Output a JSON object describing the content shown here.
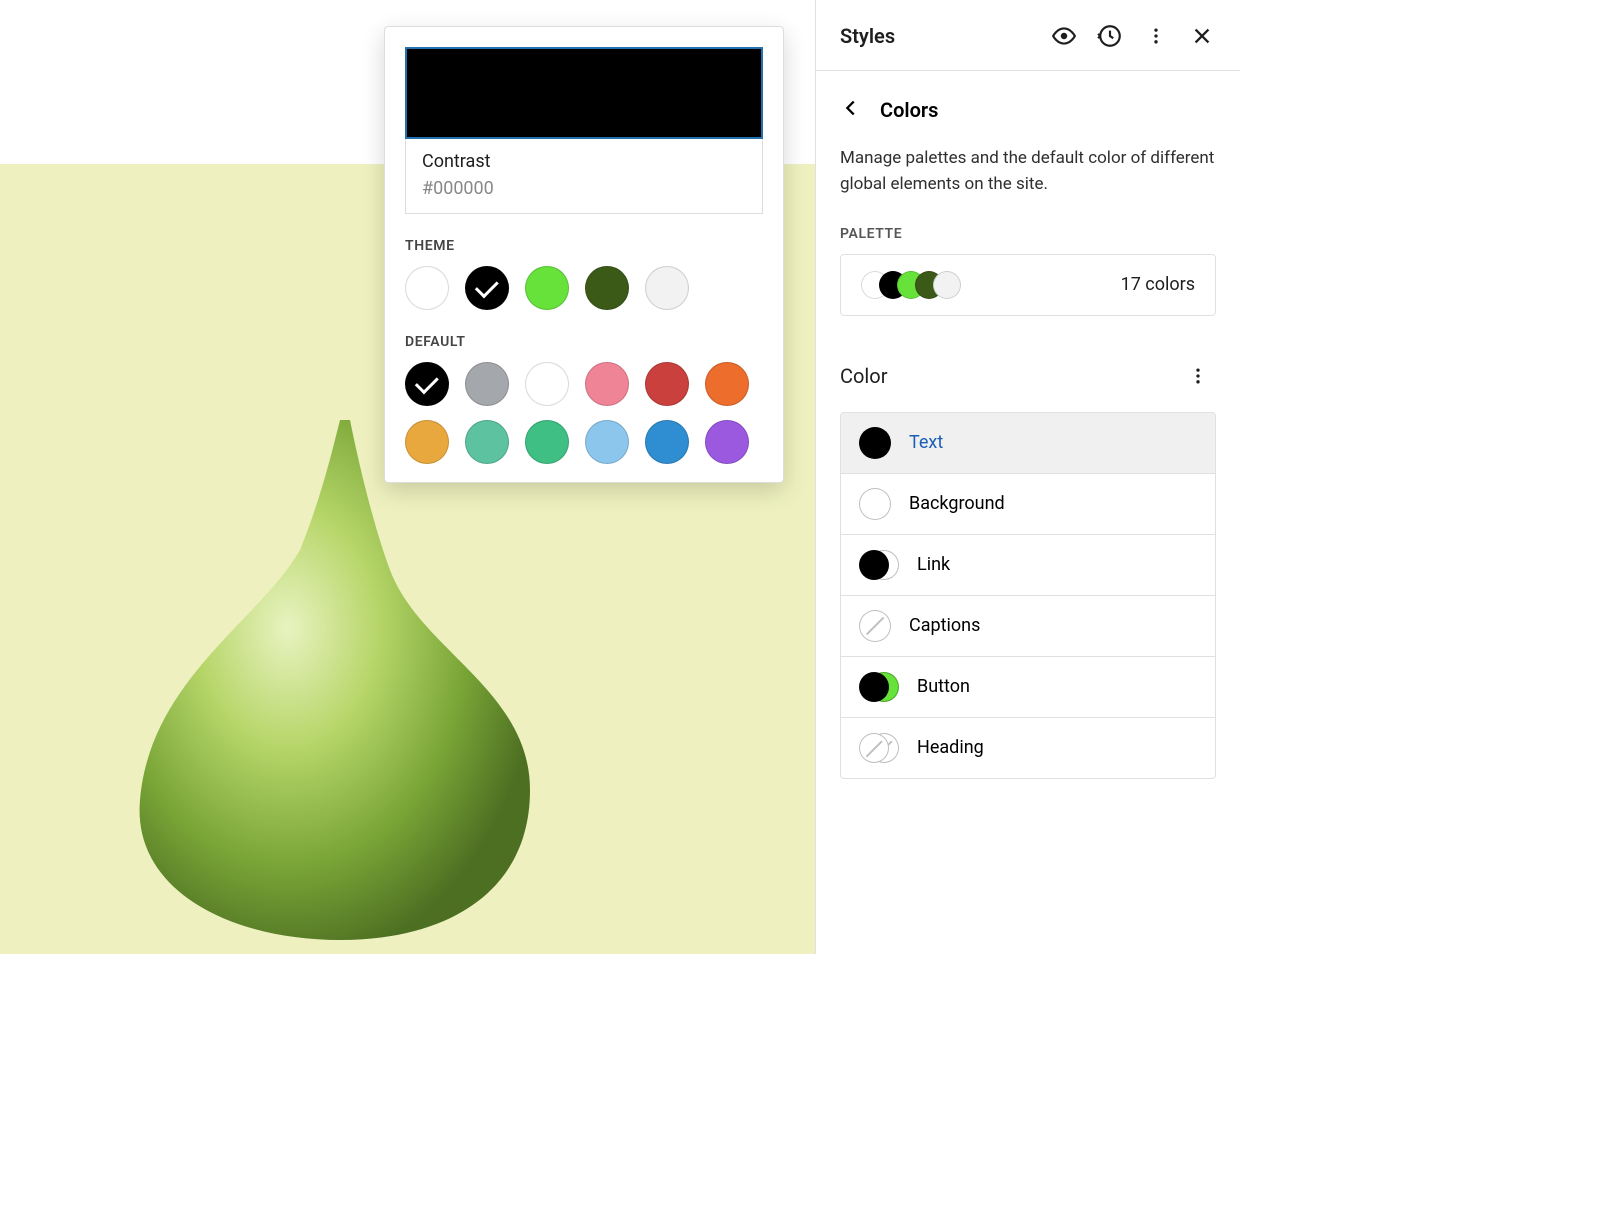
{
  "sidebar": {
    "title": "Styles",
    "subpanel_title": "Colors",
    "description": "Manage palettes and the default color of different global elements on the site.",
    "palette_label": "PALETTE",
    "palette_count": "17 colors",
    "palette_swatches": [
      "#ffffff",
      "#000000",
      "#66e23a",
      "#3b5a17",
      "#f2f2f2"
    ],
    "color_section": "Color",
    "items": [
      {
        "label": "Text",
        "kind": "single",
        "colors": [
          "#000000"
        ],
        "selected": true
      },
      {
        "label": "Background",
        "kind": "single",
        "colors": [
          "#ffffff"
        ],
        "selected": false
      },
      {
        "label": "Link",
        "kind": "dual",
        "colors": [
          "#000000",
          "#ffffff"
        ],
        "selected": false
      },
      {
        "label": "Captions",
        "kind": "single-none",
        "colors": [],
        "selected": false
      },
      {
        "label": "Button",
        "kind": "dual",
        "colors": [
          "#000000",
          "#66e23a"
        ],
        "selected": false
      },
      {
        "label": "Heading",
        "kind": "dual-none",
        "colors": [],
        "selected": false
      }
    ]
  },
  "popover": {
    "selected_name": "Contrast",
    "selected_hex": "#000000",
    "theme_label": "THEME",
    "default_label": "DEFAULT",
    "theme": [
      {
        "hex": "#ffffff"
      },
      {
        "hex": "#000000",
        "selected": true
      },
      {
        "hex": "#66e23a"
      },
      {
        "hex": "#3b5a17"
      },
      {
        "hex": "#f2f2f2"
      }
    ],
    "default": [
      {
        "hex": "#000000",
        "selected": true
      },
      {
        "hex": "#a4a7ab"
      },
      {
        "hex": "#ffffff"
      },
      {
        "hex": "#f08497"
      },
      {
        "hex": "#c9403d"
      },
      {
        "hex": "#ed6d2c"
      },
      {
        "hex": "#e9a83e"
      },
      {
        "hex": "#5dc2a0"
      },
      {
        "hex": "#3fbf84"
      },
      {
        "hex": "#8cc6ed"
      },
      {
        "hex": "#2f8dd1"
      },
      {
        "hex": "#9b59e0"
      }
    ]
  }
}
